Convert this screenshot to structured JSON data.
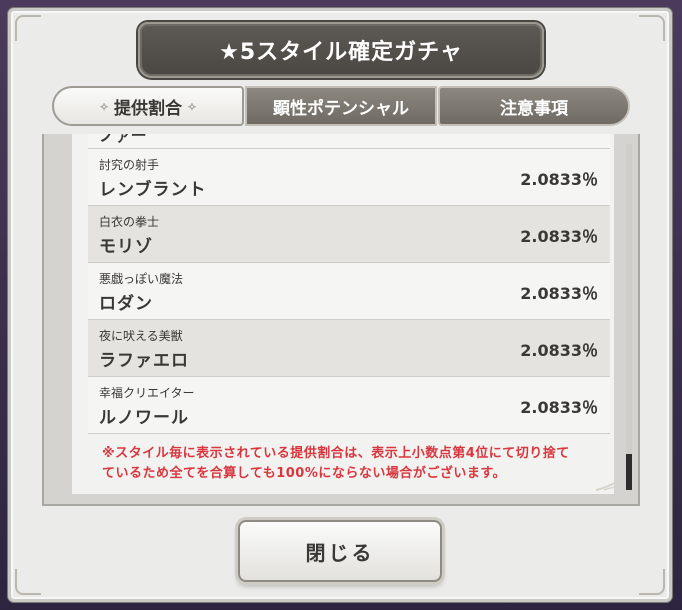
{
  "dialog": {
    "title": "★5スタイル確定ガチャ"
  },
  "tabs": [
    {
      "label": "提供割合",
      "active": true
    },
    {
      "label": "顕性ポテンシャル",
      "active": false
    },
    {
      "label": "注意事項",
      "active": false
    }
  ],
  "list": {
    "cut_row_text": "ノァー",
    "rows": [
      {
        "subtitle": "討究の射手",
        "name": "レンブラント",
        "rate": "2.0833％"
      },
      {
        "subtitle": "白衣の拳士",
        "name": "モリゾ",
        "rate": "2.0833％"
      },
      {
        "subtitle": "悪戯っぽい魔法",
        "name": "ロダン",
        "rate": "2.0833％"
      },
      {
        "subtitle": "夜に吠える美獣",
        "name": "ラファエロ",
        "rate": "2.0833％"
      },
      {
        "subtitle": "幸福クリエイター",
        "name": "ルノワール",
        "rate": "2.0833％"
      }
    ]
  },
  "notice": {
    "line1": "※スタイル毎に表示されている提供割合は、表示上小数点第4位にて切り捨て",
    "line2": "ているため全てを合算しても100%にならない場合がございます。"
  },
  "close_button": {
    "label": "閉じる"
  },
  "colors": {
    "notice": "#d9363e",
    "title_plate": "#4a4743",
    "tab_inactive": "#7a766f"
  }
}
